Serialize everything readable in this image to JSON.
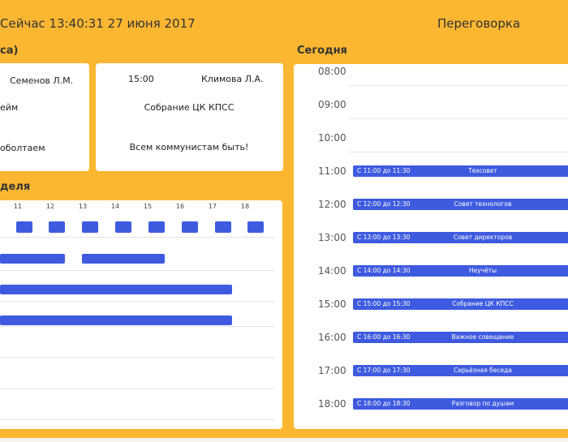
{
  "header": {
    "now": "Сейчас 13:40:31 27 июня 2017",
    "room": "Переговорка"
  },
  "left_section_title": "са)",
  "cards": [
    {
      "person": "Семенов Л.М.",
      "topic": "ейм",
      "note": "оболтаем"
    },
    {
      "time": "15:00",
      "person": "Климова Л.А.",
      "topic": "Собрание ЦК КПСС",
      "note": "Всем коммунистам быть!"
    }
  ],
  "week": {
    "title": "деля",
    "hours": [
      "11",
      "12",
      "13",
      "14",
      "15",
      "16",
      "17",
      "18"
    ],
    "accent_color": "#3E5BE0"
  },
  "today": {
    "title": "Сегодня",
    "hours": [
      "08:00",
      "09:00",
      "10:00",
      "11:00",
      "12:00",
      "13:00",
      "14:00",
      "15:00",
      "16:00",
      "17:00",
      "18:00"
    ],
    "events": [
      {
        "time": "С 11:00 до 11:30",
        "name": "Техсовет"
      },
      {
        "time": "С 12:00 до 12:30",
        "name": "Совет технологов"
      },
      {
        "time": "С 13:00 до 13:30",
        "name": "Совет директоров"
      },
      {
        "time": "С 14:00 до 14:30",
        "name": "Неучёты"
      },
      {
        "time": "С 15:00 до 15:30",
        "name": "Собрание ЦК КПСС"
      },
      {
        "time": "С 16:00 до 16:30",
        "name": "Важное совещание"
      },
      {
        "time": "С 17:00 до 17:30",
        "name": "Серьёзная беседа"
      },
      {
        "time": "С 18:00 до 18:30",
        "name": "Разговор по душам"
      }
    ]
  },
  "colors": {
    "background": "#FBB731",
    "event": "#3E5BE0",
    "card": "#FFFFFF"
  }
}
